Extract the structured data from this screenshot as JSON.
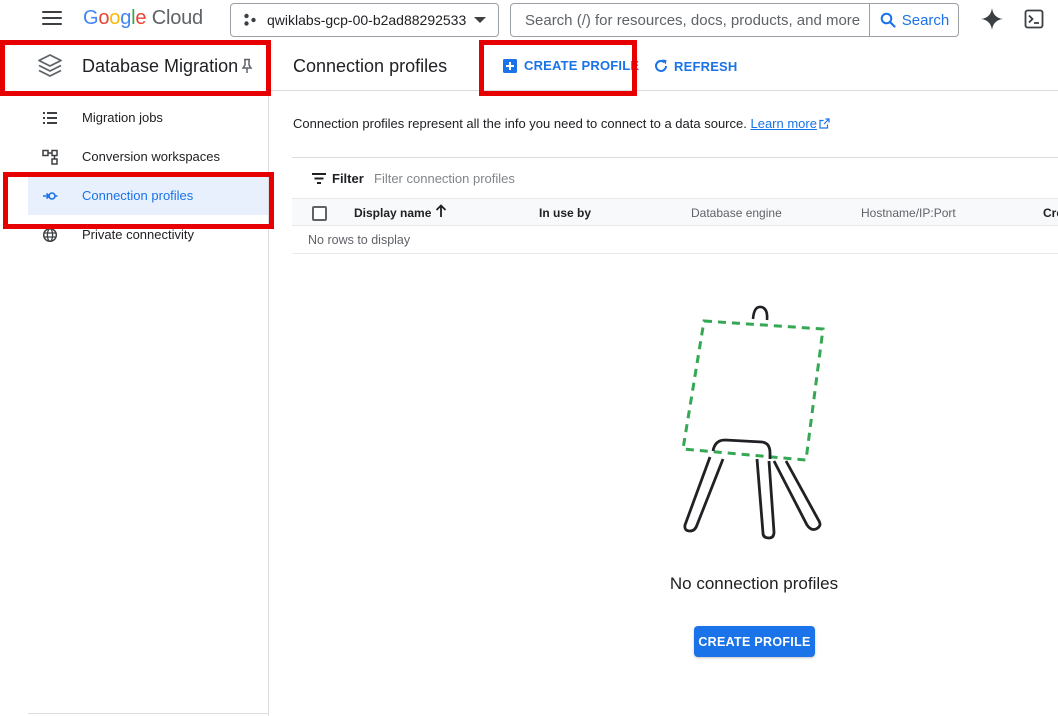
{
  "topbar": {
    "logo_google": [
      "G",
      "o",
      "o",
      "g",
      "l",
      "e"
    ],
    "logo_cloud": "Cloud",
    "project_name": "qwiklabs-gcp-00-b2ad88292533",
    "search_placeholder": "Search (/) for resources, docs, products, and more",
    "search_button": "Search"
  },
  "sidebar": {
    "product_title": "Database Migration",
    "items": [
      {
        "label": "Migration jobs",
        "icon": "list-icon"
      },
      {
        "label": "Conversion workspaces",
        "icon": "workspace-icon"
      },
      {
        "label": "Connection profiles",
        "icon": "connection-icon",
        "active": true
      },
      {
        "label": "Private connectivity",
        "icon": "globe-icon"
      }
    ]
  },
  "header": {
    "title": "Connection profiles",
    "create_profile": "CREATE PROFILE",
    "refresh": "REFRESH"
  },
  "description": {
    "text": "Connection profiles represent all the info you need to connect to a data source.",
    "learn_more": "Learn more"
  },
  "table": {
    "filter_label": "Filter",
    "filter_placeholder": "Filter connection profiles",
    "columns": [
      "Display name",
      "In use by",
      "Database engine",
      "Hostname/IP:Port",
      "Cre"
    ],
    "empty_text": "No rows to display"
  },
  "empty_state": {
    "title": "No connection profiles",
    "cta": "CREATE PROFILE"
  },
  "colors": {
    "accent": "#1a73e8",
    "annotation": "#e60000",
    "illustration_dash": "#34a853"
  }
}
